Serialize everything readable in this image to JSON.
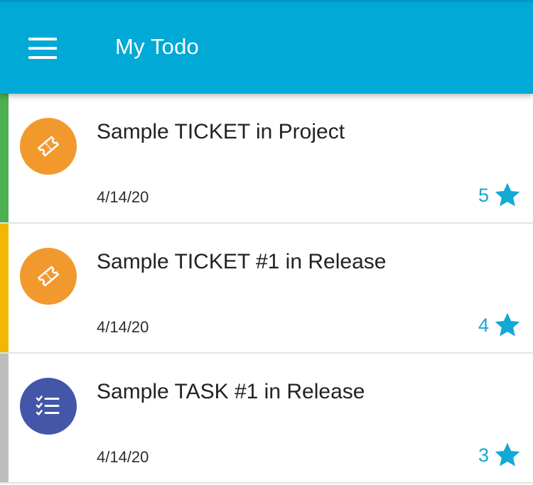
{
  "appbar": {
    "title": "My Todo",
    "color": "#00a9d6"
  },
  "icons": {
    "menu": "hamburger-menu-icon",
    "ticket": "ticket-icon",
    "task": "checklist-icon",
    "priority": "star-icon"
  },
  "items": [
    {
      "title": "Sample TICKET in Project",
      "date": "4/14/20",
      "priority": "5",
      "type": "ticket",
      "bar_color": "#4caf50",
      "avatar_color": "#f2992e"
    },
    {
      "title": "Sample TICKET #1 in Release",
      "date": "4/14/20",
      "priority": "4",
      "type": "ticket",
      "bar_color": "#f2b705",
      "avatar_color": "#f2992e"
    },
    {
      "title": "Sample TASK #1 in Release",
      "date": "4/14/20",
      "priority": "3",
      "type": "task",
      "bar_color": "#bdbdbd",
      "avatar_color": "#4456a8"
    }
  ]
}
